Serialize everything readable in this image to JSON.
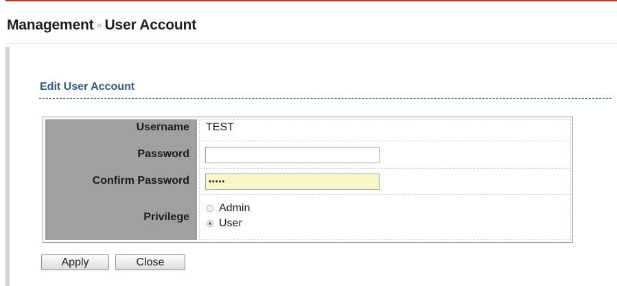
{
  "breadcrumb": {
    "parent": "Management",
    "separator": "»",
    "current": "User Account"
  },
  "section": {
    "title": "Edit User Account"
  },
  "form": {
    "username_label": "Username",
    "username_value": "TEST",
    "password_label": "Password",
    "password_value": "",
    "confirm_password_label": "Confirm Password",
    "confirm_password_value": "•••••",
    "privilege_label": "Privilege",
    "privilege_options": [
      {
        "label": "Admin",
        "selected": false
      },
      {
        "label": "User",
        "selected": true
      }
    ]
  },
  "buttons": {
    "apply_label": "Apply",
    "close_label": "Close"
  },
  "colors": {
    "accent_rule": "#b5342d",
    "section_title": "#2d5d86",
    "label_column": "#a0a0a0",
    "autofill_input": "#f7f7c7"
  }
}
